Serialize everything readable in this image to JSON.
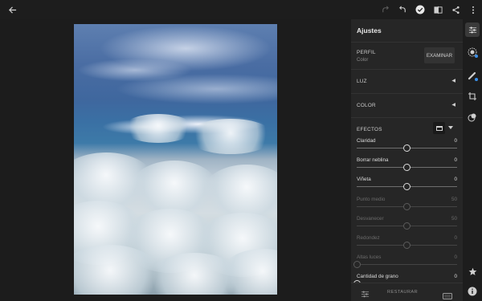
{
  "topbar": {
    "back_icon": "arrow-left-icon",
    "redo_icon": "redo-icon",
    "undo_icon": "undo-icon",
    "done_icon": "checkmark-circle-icon",
    "compare_icon": "compare-icon",
    "share_icon": "share-icon",
    "more_icon": "more-vertical-icon"
  },
  "panel": {
    "title": "Ajustes",
    "perfil": {
      "label": "PERFIL",
      "value": "Color",
      "button": "EXAMINAR"
    },
    "luz": {
      "label": "LUZ"
    },
    "color": {
      "label": "COLOR"
    },
    "efectos": {
      "label": "EFECTOS",
      "sliders": [
        {
          "label": "Claridad",
          "value": "0",
          "position": 0.5,
          "enabled": true
        },
        {
          "label": "Borrar neblina",
          "value": "0",
          "position": 0.5,
          "enabled": true
        },
        {
          "label": "Viñeta",
          "value": "0",
          "position": 0.5,
          "enabled": true
        },
        {
          "label": "Punto medio",
          "value": "50",
          "position": 0.5,
          "enabled": false
        },
        {
          "label": "Desvanecer",
          "value": "50",
          "position": 0.5,
          "enabled": false
        },
        {
          "label": "Redondez",
          "value": "0",
          "position": 0.5,
          "enabled": false
        },
        {
          "label": "Altas luces",
          "value": "0",
          "position": 0.0,
          "enabled": false
        },
        {
          "label": "Cantidad de grano",
          "value": "0",
          "position": 0.0,
          "enabled": true
        }
      ]
    },
    "restaurar": "RESTAURAR"
  },
  "rail": {
    "items": [
      "sliders-icon",
      "color-wheel-icon",
      "healing-brush-icon",
      "crop-icon",
      "presets-icon",
      "star-icon",
      "info-icon"
    ]
  },
  "colors": {
    "accent": "#3b8fe8",
    "panel_bg": "#262626",
    "canvas_bg": "#1c1c1c"
  }
}
